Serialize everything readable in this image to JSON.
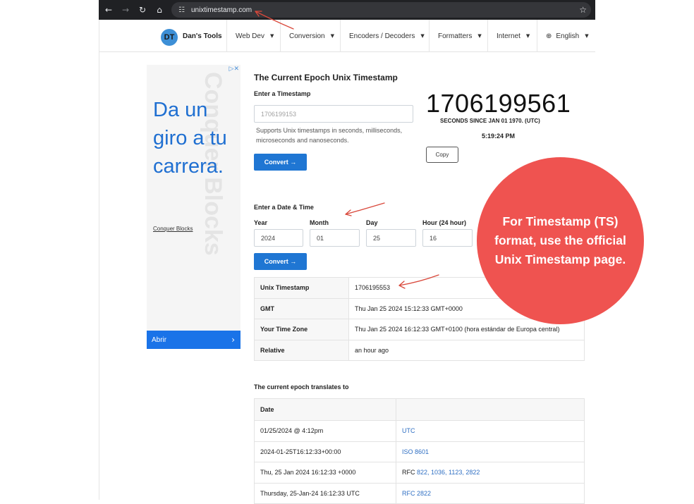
{
  "browser": {
    "url": "unixtimestamp.com"
  },
  "site": {
    "logo": "DT",
    "name": "Dan's Tools",
    "menu": [
      "Web Dev",
      "Conversion",
      "Encoders / Decoders",
      "Formatters",
      "Internet",
      "English"
    ]
  },
  "ad": {
    "headline": "Da un giro a tu carrera.",
    "watermark": "Conquer Blocks",
    "brand": "Conquer Blocks",
    "cta": "Abrir",
    "tag": "▷✕"
  },
  "epoch": {
    "title": "The Current Epoch Unix Timestamp",
    "enter_label": "Enter a Timestamp",
    "input_placeholder": "1706199153",
    "help": "Supports Unix timestamps in seconds, milliseconds, microseconds and nanoseconds.",
    "convert": "Convert →",
    "current": "1706199561",
    "since": "SECONDS SINCE JAN 01 1970. (UTC)",
    "time": "5:19:24 PM",
    "copy": "Copy"
  },
  "datetime": {
    "label": "Enter a Date & Time",
    "fields": [
      {
        "label": "Year",
        "value": "2024"
      },
      {
        "label": "Month",
        "value": "01"
      },
      {
        "label": "Day",
        "value": "25"
      },
      {
        "label": "Hour (24 hour)",
        "value": "16"
      }
    ],
    "convert": "Convert →"
  },
  "results": [
    {
      "key": "Unix Timestamp",
      "value": "1706195553"
    },
    {
      "key": "GMT",
      "value": "Thu Jan 25 2024 15:12:33 GMT+0000"
    },
    {
      "key": "Your Time Zone",
      "value": "Thu Jan 25 2024 16:12:33 GMT+0100 (hora estándar de Europa central)"
    },
    {
      "key": "Relative",
      "value": "an hour ago"
    }
  ],
  "translates": {
    "title": "The current epoch translates to",
    "header": "Date",
    "rows": [
      {
        "date": "01/25/2024 @ 4:12pm",
        "prefix": "",
        "links": "UTC"
      },
      {
        "date": "2024-01-25T16:12:33+00:00",
        "prefix": "",
        "links": "ISO 8601"
      },
      {
        "date": "Thu, 25 Jan 2024 16:12:33 +0000",
        "prefix": "RFC ",
        "links": "822, 1036, 1123, 2822"
      },
      {
        "date": "Thursday, 25-Jan-24 16:12:33 UTC",
        "prefix": "",
        "links": "RFC 2822"
      }
    ]
  },
  "callout": {
    "text": "For Timestamp (TS) format, use the official Unix Timestamp page.",
    "color": "#ef5350"
  },
  "annotation_color": "#d9483b"
}
